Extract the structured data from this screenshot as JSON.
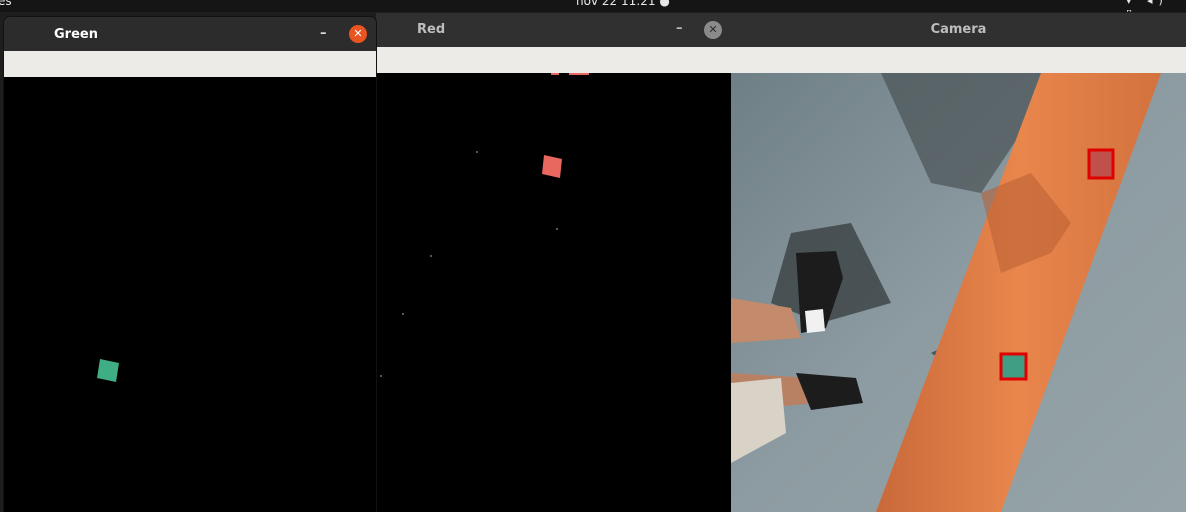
{
  "topbar": {
    "activities": "es",
    "clock": "nov 22  11:21  ●",
    "tray": "▾ ◂) ▯"
  },
  "windows": {
    "green": {
      "title": "Green",
      "minimize_icon": "minimize-icon",
      "close_icon": "close-icon",
      "minimize_glyph": "–",
      "close_glyph": "✕"
    },
    "red": {
      "title": "Red",
      "minimize_icon": "minimize-icon",
      "close_icon": "close-icon",
      "minimize_glyph": "–",
      "close_glyph": "✕"
    },
    "camera": {
      "title": "Camera"
    }
  },
  "colors": {
    "green_mask_blob": "#3fae85",
    "red_mask_blob": "#e8675f",
    "detection_box": "#e00000",
    "pipe_orange": "#e07d45",
    "floor_grey": "#7b8a8f",
    "active_close": "#e95420"
  }
}
